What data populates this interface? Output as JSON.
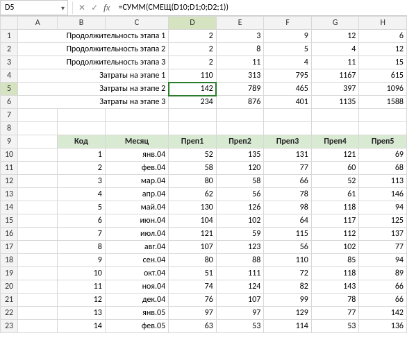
{
  "name_box": "D5",
  "formula": "=СУММ(СМЕЩ(D10;D1;0;D2;1))",
  "col_headers": [
    "A",
    "B",
    "C",
    "D",
    "E",
    "F",
    "G",
    "H"
  ],
  "row_headers": [
    "1",
    "2",
    "3",
    "4",
    "5",
    "6",
    "7",
    "8",
    "9",
    "10",
    "11",
    "12",
    "13",
    "14",
    "15",
    "16",
    "17",
    "18",
    "19",
    "20",
    "21",
    "22",
    "23"
  ],
  "top_labels": [
    "Продолжительность этапа 1",
    "Продолжительность этапа 2",
    "Продолжительность этапа 3",
    "Затраты на этапе 1",
    "Затраты на этапе 2",
    "Затраты на этапе 3"
  ],
  "top_values": [
    [
      2,
      3,
      9,
      12,
      6
    ],
    [
      2,
      8,
      5,
      4,
      12
    ],
    [
      2,
      11,
      4,
      11,
      15
    ],
    [
      110,
      313,
      795,
      1167,
      615
    ],
    [
      142,
      789,
      465,
      397,
      1096
    ],
    [
      234,
      876,
      401,
      1135,
      1588
    ]
  ],
  "tbl_headers": [
    "Код",
    "Месяц",
    "Преп1",
    "Преп2",
    "Преп3",
    "Преп4",
    "Преп5"
  ],
  "tbl_rows": [
    [
      1,
      "янв.04",
      52,
      135,
      131,
      121,
      69
    ],
    [
      2,
      "фев.04",
      58,
      120,
      77,
      60,
      68
    ],
    [
      3,
      "мар.04",
      80,
      58,
      66,
      52,
      113
    ],
    [
      4,
      "апр.04",
      62,
      56,
      78,
      61,
      146
    ],
    [
      5,
      "май.04",
      130,
      126,
      98,
      118,
      94
    ],
    [
      6,
      "июн.04",
      104,
      102,
      64,
      117,
      125
    ],
    [
      7,
      "июл.04",
      121,
      59,
      115,
      112,
      137
    ],
    [
      8,
      "авг.04",
      107,
      123,
      56,
      102,
      77
    ],
    [
      9,
      "сен.04",
      80,
      88,
      110,
      85,
      94
    ],
    [
      10,
      "окт.04",
      51,
      111,
      72,
      118,
      89
    ],
    [
      11,
      "ноя.04",
      74,
      124,
      82,
      143,
      66
    ],
    [
      12,
      "дек.04",
      76,
      107,
      99,
      78,
      66
    ],
    [
      13,
      "янв.05",
      97,
      97,
      129,
      77,
      142
    ],
    [
      14,
      "фев.05",
      63,
      53,
      114,
      53,
      136
    ]
  ],
  "icons": {
    "dropdown": "▾",
    "cancel": "✕",
    "accept": "✓",
    "fx": "fx"
  }
}
